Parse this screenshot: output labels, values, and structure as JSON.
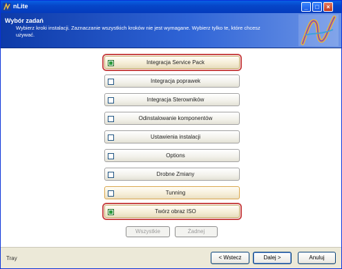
{
  "window": {
    "title": "nLite"
  },
  "header": {
    "title": "Wybór zadań",
    "description": "Wybierz kroki instalacji. Zaznaczanie wszystkich kroków nie jest wymagane. Wybierz tylko te, które chcesz używać."
  },
  "tasks": [
    {
      "label": "Integracja Service Pack",
      "checked": true
    },
    {
      "label": "Integracja poprawek",
      "checked": false
    },
    {
      "label": "Integracja Sterowników",
      "checked": false
    },
    {
      "label": "Odinstalowanie komponentów",
      "checked": false
    },
    {
      "label": "Ustawienia instalacji",
      "checked": false
    },
    {
      "label": "Options",
      "checked": false
    },
    {
      "label": "Drobne Zmiany",
      "checked": false
    },
    {
      "label": "Tunning",
      "checked": false
    },
    {
      "label": "Twórz obraz ISO",
      "checked": true
    }
  ],
  "selection_buttons": {
    "all": "Wszystkie",
    "none": "Żadnej"
  },
  "footer": {
    "status": "Tray",
    "back": "< Wstecz",
    "next": "Dalej >",
    "cancel": "Anuluj"
  }
}
